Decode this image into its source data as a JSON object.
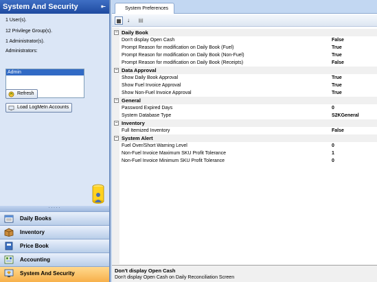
{
  "left_panel": {
    "title": "System And Security",
    "users_info": "1 User(s).",
    "groups_info": "12 Privilege Group(s).",
    "admins_info": "1 Administrator(s).",
    "admins_label": "Administrators:",
    "admin_list": [
      "Admin"
    ],
    "refresh_label": "Refresh",
    "logmein_label": "Load LogMeIn Accounts"
  },
  "nav": [
    {
      "label": "Daily Books",
      "icon": "daily-books-icon"
    },
    {
      "label": "Inventory",
      "icon": "inventory-box-icon"
    },
    {
      "label": "Price Book",
      "icon": "price-book-icon"
    },
    {
      "label": "Accounting",
      "icon": "accounting-icon"
    },
    {
      "label": "System And Security",
      "icon": "system-security-icon",
      "active": true
    }
  ],
  "tab_label": "System Preferences",
  "categories": [
    {
      "name": "Daily Book",
      "rows": [
        {
          "name": "Don't display Open Cash",
          "value": "False"
        },
        {
          "name": "Prompt Reason for modification on Daily Book (Fuel)",
          "value": "True"
        },
        {
          "name": "Prompt Reason for modification on Daily Book (Non-Fuel)",
          "value": "True"
        },
        {
          "name": "Prompt Reason for modification on Daily Book (Receipts)",
          "value": "False"
        }
      ]
    },
    {
      "name": "Data Approval",
      "rows": [
        {
          "name": "Show Daily Book Approval",
          "value": "True"
        },
        {
          "name": "Show Fuel Invoice Approval",
          "value": "True"
        },
        {
          "name": "Show Non-Fuel Invoice Approval",
          "value": "True"
        }
      ]
    },
    {
      "name": "General",
      "rows": [
        {
          "name": "Password Expired Days",
          "value": "0"
        },
        {
          "name": "System Database Type",
          "value": "S2KGeneral"
        }
      ]
    },
    {
      "name": "Inventory",
      "rows": [
        {
          "name": "Full Itemized Inventory",
          "value": "False"
        }
      ]
    },
    {
      "name": "System Alert",
      "rows": [
        {
          "name": "Fuel Over/Short Warning Level",
          "value": "0"
        },
        {
          "name": "Non-Fuel Invoice Maximum SKU Profit Tolerance",
          "value": "1"
        },
        {
          "name": "Non-Fuel Invoice Minimum SKU Profit Tolerance",
          "value": "0"
        }
      ]
    }
  ],
  "description": {
    "title": "Don't display Open Cash",
    "text": "Don't display Open Cash on Daily Reconciliation Screen"
  },
  "colors": {
    "accent": "#1e4aa0",
    "active_nav": "#f7b04a",
    "selection": "#316ac5"
  }
}
